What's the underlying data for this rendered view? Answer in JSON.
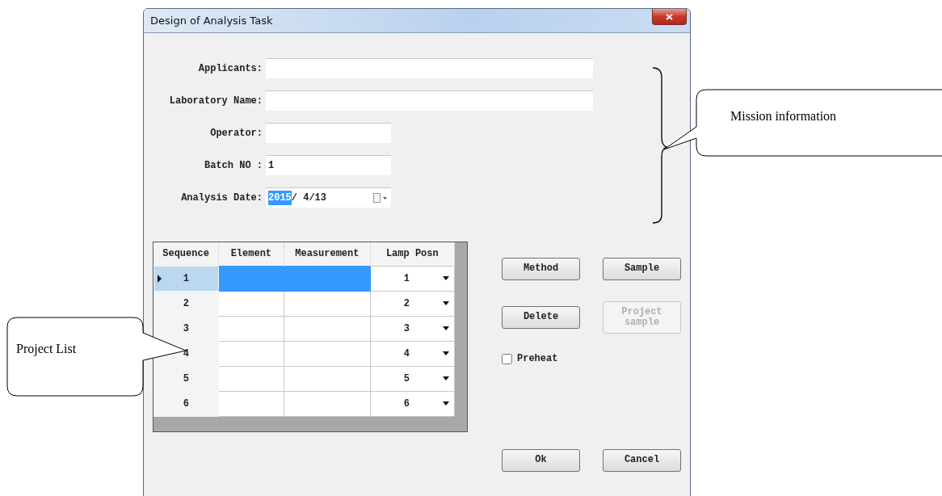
{
  "window": {
    "title": "Design of Analysis Task"
  },
  "fields": [
    {
      "kind": "long",
      "label": "Applicants:"
    },
    {
      "kind": "long",
      "label": "Laboratory Name:"
    },
    {
      "kind": "short",
      "label": "Operator:"
    },
    {
      "kind": "short",
      "label": "Batch NO :",
      "value": "1"
    },
    {
      "kind": "date",
      "label": "Analysis Date:",
      "selected_text": "2015",
      "value": "/ 4/13"
    }
  ],
  "table": {
    "columns": [
      "Sequence",
      "Element",
      "Measurement",
      "Lamp Posn"
    ],
    "rows": [
      {
        "sequence": "1",
        "lamp_posn": "1",
        "selected": true
      },
      {
        "sequence": "2",
        "lamp_posn": "2",
        "selected": false
      },
      {
        "sequence": "3",
        "lamp_posn": "3",
        "selected": false
      },
      {
        "sequence": "4",
        "lamp_posn": "4",
        "selected": false
      },
      {
        "sequence": "5",
        "lamp_posn": "5",
        "selected": false
      },
      {
        "sequence": "6",
        "lamp_posn": "6",
        "selected": false
      }
    ]
  },
  "buttons": [
    {
      "label": "Method",
      "disabled": false
    },
    {
      "label": "Sample",
      "disabled": false
    },
    {
      "label": "Delete",
      "disabled": false
    },
    {
      "label": "Project sample",
      "disabled": true
    }
  ],
  "preheat": {
    "label": "Preheat",
    "checked": false
  },
  "footer_buttons": [
    {
      "label": "Ok"
    },
    {
      "label": "Cancel"
    }
  ],
  "annotations": [
    {
      "kind": "brace-callout",
      "text": "Mission information"
    },
    {
      "kind": "callout",
      "text": "Project List"
    }
  ]
}
